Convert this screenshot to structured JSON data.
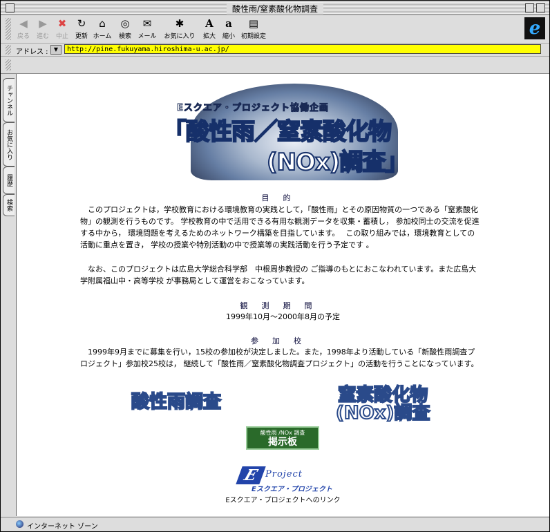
{
  "window": {
    "title": "酸性雨/窒素酸化物調査"
  },
  "toolbar": {
    "buttons": [
      {
        "label": "戻る",
        "icon": "◀",
        "disabled": true
      },
      {
        "label": "進む",
        "icon": "▶",
        "disabled": true
      },
      {
        "label": "中止",
        "icon": "✖",
        "disabled": true
      },
      {
        "label": "更新",
        "icon": "↻",
        "disabled": false
      },
      {
        "label": "ホーム",
        "icon": "⌂",
        "disabled": false
      },
      {
        "label": "検索",
        "icon": "◎",
        "disabled": false
      },
      {
        "label": "メール",
        "icon": "✉",
        "disabled": false
      },
      {
        "label": "お気に入り",
        "icon": "✱",
        "disabled": false
      },
      {
        "label": "拡大",
        "icon": "A",
        "disabled": false
      },
      {
        "label": "縮小",
        "icon": "a",
        "disabled": false
      },
      {
        "label": "初期設定",
        "icon": "▤",
        "disabled": false
      }
    ]
  },
  "address": {
    "label": "アドレス :",
    "url": "http://pine.fukuyama.hiroshima-u.ac.jp/"
  },
  "sidetabs": [
    "チャンネル",
    "お気に入り",
    "履歴",
    "検索"
  ],
  "banner": {
    "subtitle": "Eスクエア・プロジェクト協働企画",
    "title_line1": "「酸性雨／窒素酸化物",
    "title_line2": "(NOx)調査」"
  },
  "content": {
    "purpose_heading": "目的",
    "purpose_p1": "このプロジェクトは，学校教育における環境教育の実践として，「酸性雨」とその原因物質の一つである「窒素酸化物」の観測を行うものです。 学校教育の中で活用できる有用な観測データを収集・蓄積し， 参加校同士の交流を促進する中から， 環境問題を考えるためのネットワーク構築を目指しています。　 この取り組みでは，環境教育としての活動に重点を置き， 学校の授業や特別活動の中で授業等の実践活動を行う予定です 。",
    "purpose_p2": "なお、このプロジェクトは広島大学総合科学部　中根周歩教授の ご指導のもとにおこなわれています。また広島大学附属福山中・高等学校 が事務局として運営をおこなっています。",
    "period_heading": "観測期間",
    "period_text": "1999年10月〜2000年8月の予定",
    "schools_heading": "参加校",
    "schools_text": "1999年9月までに募集を行い，15校の参加校が決定しました。また，1998年より活動している「新酸性雨調査プロジェクト」参加校25校は， 継続して「酸性雨／窒素酸化物調査プロジェクト」の活動を行うことになっています。",
    "link_acid": "酸性雨調査",
    "link_nox_line1": "窒素酸化物",
    "link_nox_line2": "(NOx)調査",
    "board_top": "酸性雨 /NOx 調査",
    "board_bottom": "掲示板",
    "elogo_e": "E",
    "elogo_project": "Project",
    "elogo_square": "Eスクエア・プロジェクト",
    "elink_caption": "Eスクエア・プロジェクトへのリンク"
  },
  "status": {
    "text": "インターネット ゾーン"
  }
}
